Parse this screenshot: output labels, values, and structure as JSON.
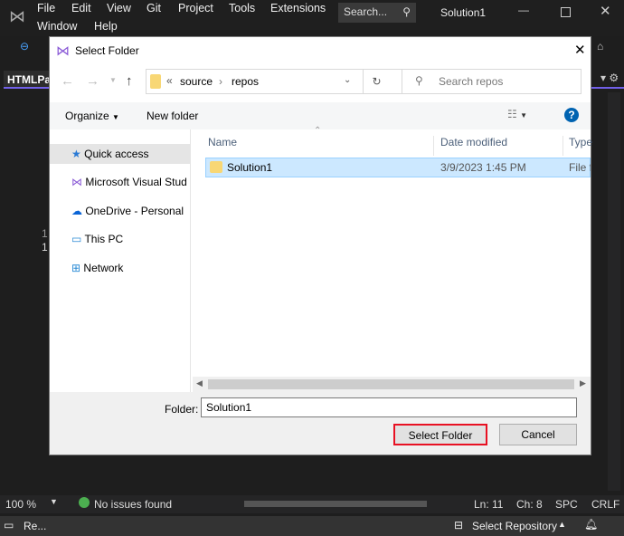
{
  "vs": {
    "menu": [
      "File",
      "Edit",
      "View",
      "Git",
      "Project",
      "Tools",
      "Extensions",
      "Window",
      "Help"
    ],
    "search": "Search...",
    "solution": "Solution1",
    "tab": "HTMLPa",
    "line_numbers": [
      "1",
      "1"
    ]
  },
  "status": {
    "zoom": "100 %",
    "issues": "No issues found",
    "ln": "Ln: 11",
    "ch": "Ch: 8",
    "spc": "SPC",
    "crlf": "CRLF"
  },
  "bottom": {
    "left": "Re...",
    "repo": "Select Repository"
  },
  "dialog": {
    "title": "Select Folder",
    "path": [
      "source",
      "repos"
    ],
    "search_placeholder": "Search repos",
    "organize": "Organize",
    "new_folder": "New folder",
    "nav": [
      "Quick access",
      "Microsoft Visual Stud",
      "OneDrive - Personal",
      "This PC",
      "Network"
    ],
    "columns": [
      "Name",
      "Date modified",
      "Type"
    ],
    "rows": [
      {
        "name": "Solution1",
        "date": "3/9/2023 1:45 PM",
        "type": "File fo"
      }
    ],
    "folder_label": "Folder:",
    "folder_value": "Solution1",
    "select": "Select Folder",
    "cancel": "Cancel"
  },
  "colors": {
    "accent": "#0078d4",
    "highlight": "#e81123",
    "selection": "#cce8ff"
  }
}
